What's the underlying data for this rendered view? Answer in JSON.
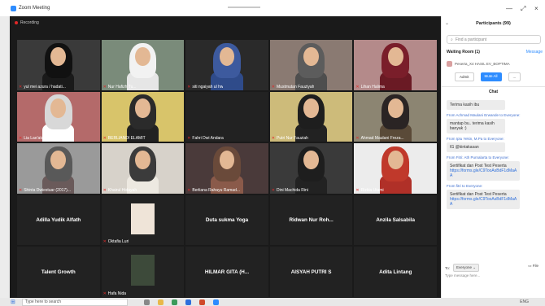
{
  "window": {
    "title": "Zoom Meeting",
    "controls": [
      "—",
      "⤢",
      "×"
    ]
  },
  "recording": "Recording",
  "colors": {
    "accent": "#2d8cff",
    "mute": "#e02828",
    "video_bg": "#1a1a1a"
  },
  "tiles": [
    {
      "name": "yul mei azura / hadati...",
      "muted": true,
      "kind": "video",
      "bg": "#3a3a3a",
      "hijab": "#111111",
      "body": "#1a1a1a"
    },
    {
      "name": "Nur Hafizh Tu...",
      "muted": true,
      "kind": "video",
      "bg": "#7a8b7a",
      "hijab": "#f2f2f2",
      "body": "#e6e6e6"
    },
    {
      "name": "siti ngaiyah ul hw",
      "muted": true,
      "kind": "video",
      "bg": "#2a2a2a",
      "hijab": "#3d5a9e",
      "body": "#2f4b8a"
    },
    {
      "name": "Mustmutan Fauziyah",
      "muted": true,
      "kind": "video",
      "bg": "#8a7a72",
      "hijab": "#5c5c5c",
      "body": "#4e4e4e"
    },
    {
      "name": "Lihan Halima",
      "muted": true,
      "kind": "video",
      "bg": "#b48a8a",
      "hijab": "#7a1e2a",
      "body": "#6a1a24"
    },
    {
      "name": "Lia Lae'atu Faudah",
      "muted": true,
      "kind": "video",
      "bg": "#b46a6a",
      "hijab": "#d8d8d8",
      "body": "#ffffff"
    },
    {
      "name": "BERLIANDI ELAMIT",
      "muted": true,
      "kind": "video",
      "bg": "#d8c46a",
      "hijab": "#2b2b2b",
      "body": "#222222"
    },
    {
      "name": "Fahri Dwi Andara",
      "muted": true,
      "kind": "blank",
      "bg": "#222222"
    },
    {
      "name": "Putri Nur Fauziah",
      "muted": true,
      "kind": "video",
      "bg": "#cdbb7a",
      "hijab": "#1e1e1e",
      "body": "#222222"
    },
    {
      "name": "Ahmad Maulani Freza...",
      "muted": true,
      "kind": "video",
      "bg": "#8c8572",
      "hijab": "#2a2424",
      "body": "#5a4a38"
    },
    {
      "name": "Shinta Dwiestuar (2017)...",
      "muted": true,
      "kind": "video",
      "bg": "#9a9a9a",
      "hijab": "#595959",
      "body": "#6a5a5a"
    },
    {
      "name": "Khairul Hidayah",
      "muted": true,
      "kind": "video",
      "bg": "#d7d2ca",
      "hijab": "#3b3b3b",
      "body": "#ede9e1"
    },
    {
      "name": "Berliana Rahayu Ramad...",
      "muted": true,
      "kind": "video",
      "bg": "#4a3a3a",
      "hijab": "#6a4a3a",
      "body": "#8a5a4a"
    },
    {
      "name": "Dini Machida Rini",
      "muted": true,
      "kind": "video",
      "bg": "#3a3a3a",
      "hijab": "#1e1e1e",
      "body": "#222222"
    },
    {
      "name": "Rizkia Utami",
      "muted": true,
      "kind": "video",
      "bg": "#ececec",
      "hijab": "#c0392b",
      "body": "#b03028"
    },
    {
      "name": "Adilla Yudik Alfath",
      "muted": false,
      "kind": "name"
    },
    {
      "name": "Oktafia Luri",
      "muted": true,
      "kind": "small",
      "bg": "#efe4d8",
      "hijab": "#b21f1f",
      "body": "#b21f1f"
    },
    {
      "name": "Duta sukma Yoga",
      "muted": false,
      "kind": "name"
    },
    {
      "name": "Ridwan Nur Roh...",
      "muted": false,
      "kind": "name"
    },
    {
      "name": "Anzila Salsabila",
      "muted": false,
      "kind": "name"
    },
    {
      "name": "Talent Growth",
      "muted": false,
      "kind": "name"
    },
    {
      "name": "Hafa Nida",
      "muted": true,
      "kind": "small",
      "bg": "#3d4a3a",
      "hijab": "#5a6a4a",
      "body": "#4a5a3a"
    },
    {
      "name": "HILMAR GITA (H...",
      "muted": false,
      "kind": "name"
    },
    {
      "name": "AISYAH PUTRI S",
      "muted": false,
      "kind": "name"
    },
    {
      "name": "Adita Lintang",
      "muted": false,
      "kind": "name"
    }
  ],
  "panel": {
    "title": "Participants (99)",
    "search_placeholder": "Find a participant",
    "waiting_room": "Waiting Room (1)",
    "message": "Message",
    "waiting_person": "Peserta_X4 HASIL EV_BOPTIMA",
    "admit": "Admit",
    "mute_all": "Mute All",
    "more": "...",
    "chat_title": "Chat"
  },
  "chat": [
    {
      "from": "",
      "text": "Terima kasih ibu",
      "link": false,
      "width": "narrow"
    },
    {
      "from": "From Achmad Maulani Erwande to Everyone:",
      "text": "mantap bu.. terima kasih banyak :)",
      "link": false,
      "width": "narrow"
    },
    {
      "from": "From Iptu Yekin, M.Pa to Everyone:",
      "text": "IG @kintakasan",
      "link": false,
      "width": "narrow"
    },
    {
      "from": "From Fitri: Ath Purnalarta to Everyone:",
      "text": "Sertifikat dan Post Test Peserta",
      "linktext": "https://forms.gle/C9TooAsBdF1dMaAA",
      "link": true,
      "width": "wide"
    },
    {
      "from": "From fitri to Everyone:",
      "text": "Sertifikat dan Post Test Peserta",
      "linktext": "https://forms.gle/C9TooAsBdF1dMaAA",
      "link": true,
      "width": "wide"
    }
  ],
  "chat_footer": {
    "to_label": "To:",
    "recipient": "Everyone",
    "file": "File",
    "placeholder": "Type message here..."
  },
  "taskbar": {
    "search": "Type here to search",
    "tray": "ENG"
  }
}
